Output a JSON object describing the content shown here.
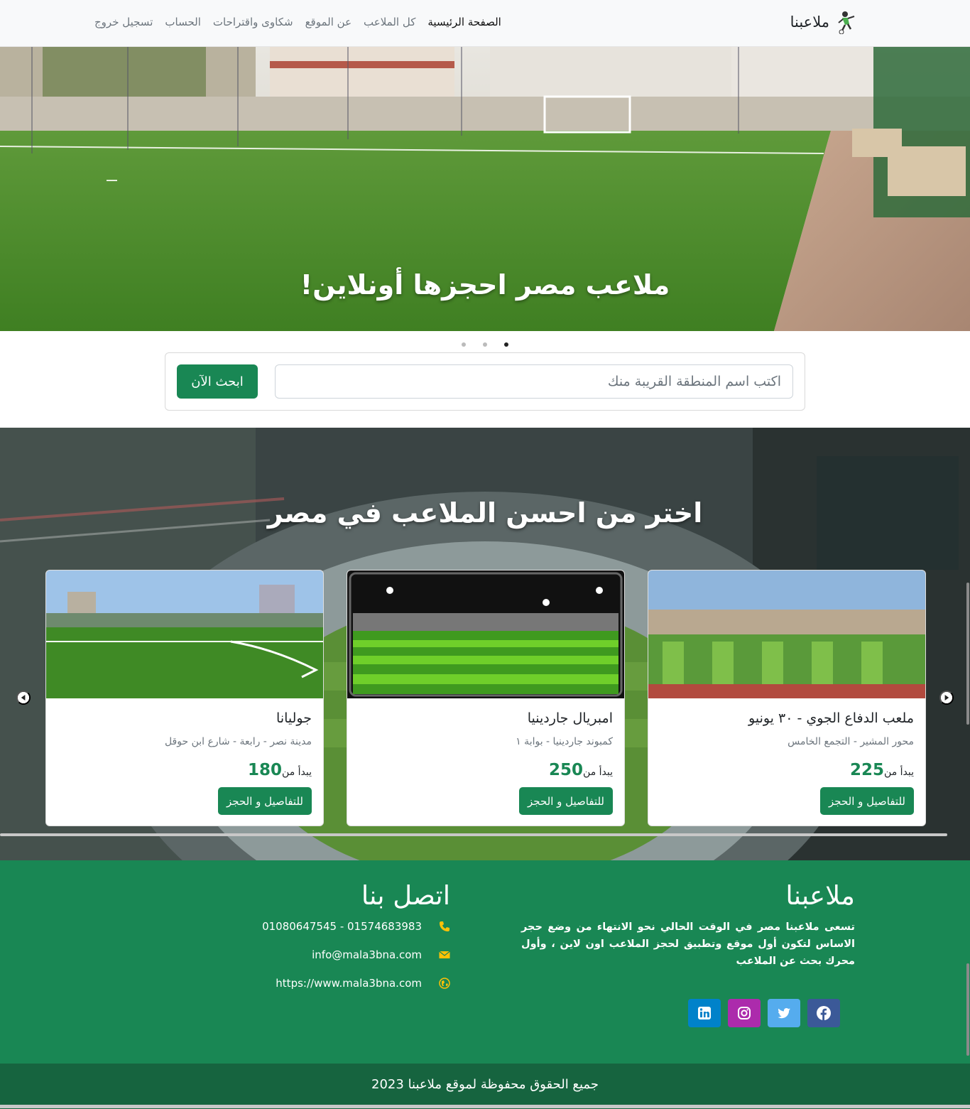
{
  "navbar": {
    "brand": "ملاعبنا",
    "links": [
      {
        "label": "الصفحة الرئيسية",
        "active": true
      },
      {
        "label": "كل الملاعب"
      },
      {
        "label": "عن الموقع"
      },
      {
        "label": "شكاوى واقتراحات"
      },
      {
        "label": "الحساب"
      },
      {
        "label": "تسجيل خروج"
      }
    ]
  },
  "hero": {
    "caption": "ملاعب مصر احجزها أونلاين!",
    "slides": 3,
    "active_slide": 3
  },
  "search": {
    "placeholder": "اكتب اسم المنطقة القريبة منك",
    "button": "ابحث الآن"
  },
  "fields_section": {
    "title": "اختر من احسن الملاعب في مصر",
    "cards": [
      {
        "name": "ملعب الدفاع الجوي - ٣٠ يونيو",
        "location": "محور المشير - التجمع الخامس",
        "price_prefix": "يبدأ من",
        "price": "225",
        "button": "للتفاصيل و الحجز"
      },
      {
        "name": "امبريال جاردينيا",
        "location": "كمبوند جاردينيا - بوابة ١",
        "price_prefix": "يبدأ من",
        "price": "250",
        "button": "للتفاصيل و الحجز"
      },
      {
        "name": "جوليانا",
        "location": "مدينة نصر - رابعة - شارع ابن حوقل",
        "price_prefix": "يبدأ من",
        "price": "180",
        "button": "للتفاصيل و الحجز"
      }
    ]
  },
  "footer": {
    "brand": "ملاعبنا",
    "about": "تسعى ملاعبنا مصر في الوقت الحالي نحو الانتهاء من وضع حجر الاساس لتكون أول موقع وتطبيق لحجز الملاعب اون لاين ، وأول محرك بحث عن الملاعب",
    "contact_title": "اتصل بنا",
    "phone": "01574683983 - 01080647545",
    "email": "info@mala3bna.com",
    "website": "https://www.mala3bna.com",
    "icon_color": "#ffc107",
    "socials": [
      {
        "name": "facebook-icon",
        "color": "#3b5998"
      },
      {
        "name": "twitter-icon",
        "color": "#55acee"
      },
      {
        "name": "instagram-icon",
        "color": "#ac2bac"
      },
      {
        "name": "linkedin-icon",
        "color": "#0082ca"
      }
    ]
  },
  "copyright": "جميع الحقوق محفوظة لموقع ملاعبنا 2023"
}
